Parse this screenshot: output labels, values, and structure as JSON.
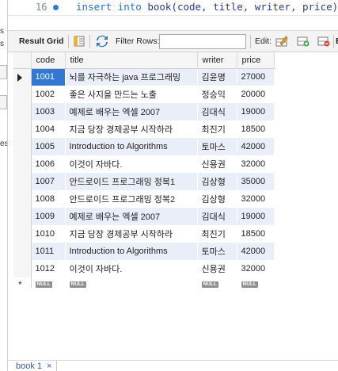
{
  "sidebar_fragments": {
    "a": "s",
    "b": "s",
    "c": "es"
  },
  "editor": {
    "line_number": "16",
    "code_keyword": "insert into",
    "code_rest": "book(code, title, writer, price) va"
  },
  "toolbar": {
    "result_grid_label": "Result Grid",
    "filter_rows_label": "Filter Rows:",
    "filter_rows_value": "",
    "edit_label": "Edit:",
    "ex_label": "E"
  },
  "grid": {
    "columns": [
      "code",
      "title",
      "writer",
      "price"
    ],
    "rows": [
      {
        "code": "1001",
        "title": "뇌를 자극하는 java 프로그래밍",
        "writer": "김윤명",
        "price": "27000"
      },
      {
        "code": "1002",
        "title": "좋은 사지을 만드는 노출",
        "writer": "정승익",
        "price": "20000"
      },
      {
        "code": "1003",
        "title": "예제로 배우는 엑셀 2007",
        "writer": "김대식",
        "price": "19000"
      },
      {
        "code": "1004",
        "title": "지금 당장 경제공부 시작하라",
        "writer": "최진기",
        "price": "18500"
      },
      {
        "code": "1005",
        "title": "Introduction to Algorithms",
        "writer": "토마스",
        "price": "42000"
      },
      {
        "code": "1006",
        "title": "이것이 자바다.",
        "writer": "신용권",
        "price": "32000"
      },
      {
        "code": "1007",
        "title": "안드로이드 프로그래밍 정복1",
        "writer": "김상형",
        "price": "35000"
      },
      {
        "code": "1008",
        "title": "안드로이드 프로그래밍 정복2",
        "writer": "김상형",
        "price": "32000"
      },
      {
        "code": "1009",
        "title": "예제로 배우는 엑셀 2007",
        "writer": "김대식",
        "price": "19000"
      },
      {
        "code": "1010",
        "title": "지금 당장 경제공부 시작하라",
        "writer": "최진기",
        "price": "18500"
      },
      {
        "code": "1011",
        "title": "Introduction to Algorithms",
        "writer": "토마스",
        "price": "42000"
      },
      {
        "code": "1012",
        "title": "이것이 자바다.",
        "writer": "신용권",
        "price": "32000"
      }
    ],
    "null_label": "NULL",
    "new_row_marker": "*"
  },
  "bottom_tab": {
    "label": "book 1",
    "close": "×"
  },
  "colors": {
    "selection": "#3278d2",
    "odd_row": "#e9eef9",
    "keyword": "#2070d0"
  }
}
